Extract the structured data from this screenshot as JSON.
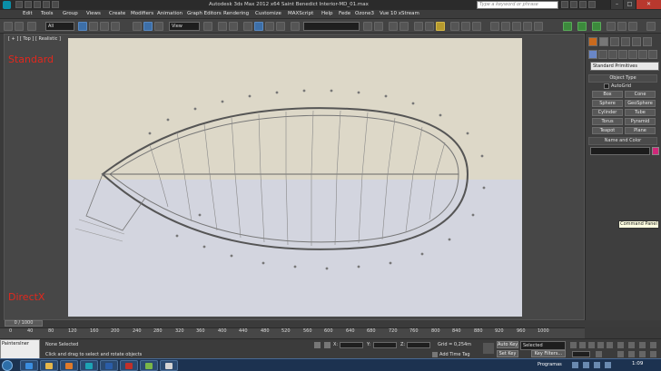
{
  "window": {
    "title": "Autodesk 3ds Max  2012 x64     Saint Benedict Interior-MD_01.max",
    "search_placeholder": "Type a keyword or phrase"
  },
  "menu": [
    "Edit",
    "Tools",
    "Group",
    "Views",
    "Create",
    "Modifiers",
    "Animation",
    "Graph Editors",
    "Rendering",
    "Customize",
    "MAXScript",
    "Help",
    "Fede",
    "Ozone3",
    "Vue 10 xStream"
  ],
  "toolbar": {
    "selection_filter": "All",
    "reference_coord": "View"
  },
  "viewport": {
    "label": "[ + ] [ Top ] [ Realistic ]",
    "overlay_standard": "Standard",
    "overlay_directx": "DirectX"
  },
  "command_panel": {
    "category": "Standard Primitives",
    "object_type_header": "Object Type",
    "autogrid": "AutoGrid",
    "objects": [
      "Box",
      "Cone",
      "Sphere",
      "GeoSphere",
      "Cylinder",
      "Tube",
      "Torus",
      "Pyramid",
      "Teapot",
      "Plane"
    ],
    "name_color_header": "Name and Color",
    "name_color_swatch": "#d0287a"
  },
  "tooltip": "Command Panel",
  "timeline": {
    "slider": "0 / 1000",
    "ticks": [
      "0",
      "40",
      "80",
      "120",
      "160",
      "200",
      "240",
      "280",
      "320",
      "360",
      "400",
      "440",
      "480",
      "520",
      "560",
      "600",
      "640",
      "680",
      "720",
      "760",
      "800",
      "840",
      "880",
      "920",
      "960",
      "1000"
    ]
  },
  "status": {
    "maxscript": "PaintersIner",
    "selection": "None Selected",
    "prompt": "Click and drag to select and rotate objects",
    "x_label": "X:",
    "y_label": "Y:",
    "z_label": "Z:",
    "grid": "Grid = 0,254m",
    "add_time_tag": "Add Time Tag",
    "auto_key": "Auto Key",
    "set_key": "Set Key",
    "key_mode": "Selected",
    "key_filters": "Key Filters..."
  },
  "taskbar": {
    "programas": "Programas",
    "clock": "1:09"
  }
}
